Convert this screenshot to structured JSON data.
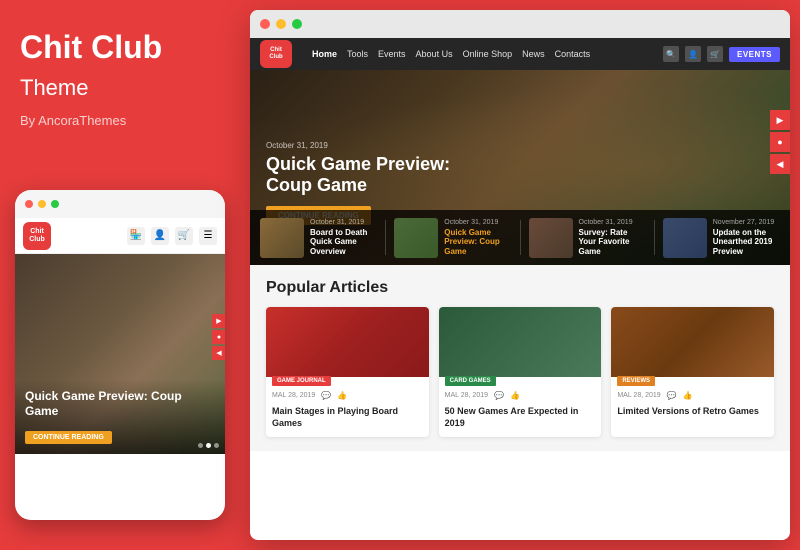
{
  "left": {
    "title": "Chit Club",
    "subtitle": "Theme",
    "byline": "By AncoraThemes"
  },
  "mobile": {
    "logo_line1": "Chit",
    "logo_line2": "Club",
    "hero_title": "Quick Game Preview: Coup Game",
    "hero_btn": "CONTINUE READING"
  },
  "browser": {
    "dots": [
      "red",
      "yellow",
      "green"
    ],
    "nav": {
      "logo_line1": "Chit",
      "logo_line2": "Club",
      "links": [
        "Home",
        "Tools",
        "Events",
        "About Us",
        "Online Shop",
        "News",
        "Contacts"
      ],
      "active_link": "Home",
      "events_btn": "EVENTS"
    },
    "hero": {
      "date": "October 31, 2019",
      "title_line1": "Quick Game Preview:",
      "title_line2": "Coup Game",
      "btn": "CONTINUE READING"
    },
    "strip": [
      {
        "date": "October 31, 2019",
        "title": "Board to Death Quick Game Overview",
        "thumb": "t1"
      },
      {
        "date": "October 31, 2019",
        "title": "Quick Game Preview: Coup Game",
        "thumb": "t2",
        "highlight": true
      },
      {
        "date": "October 31, 2019",
        "title": "Survey: Rate Your Favorite Game",
        "thumb": "t3"
      },
      {
        "date": "November 27, 2019",
        "title": "Update on the Unearthed 2019 Preview",
        "thumb": "t4"
      }
    ],
    "popular": {
      "section_title": "Popular Articles",
      "articles": [
        {
          "tag": "GAME JOURNAL",
          "tag_color": "red",
          "date": "MAL 28, 2019",
          "title": "Main Stages in Playing Board Games",
          "img": "a1"
        },
        {
          "tag": "CARD GAMES",
          "tag_color": "green",
          "date": "MAL 28, 2019",
          "title": "50 New Games Are Expected in 2019",
          "img": "a2"
        },
        {
          "tag": "REVIEWS",
          "tag_color": "orange",
          "date": "MAL 28, 2019",
          "title": "Limited Versions of Retro Games",
          "img": "a3"
        }
      ]
    }
  }
}
